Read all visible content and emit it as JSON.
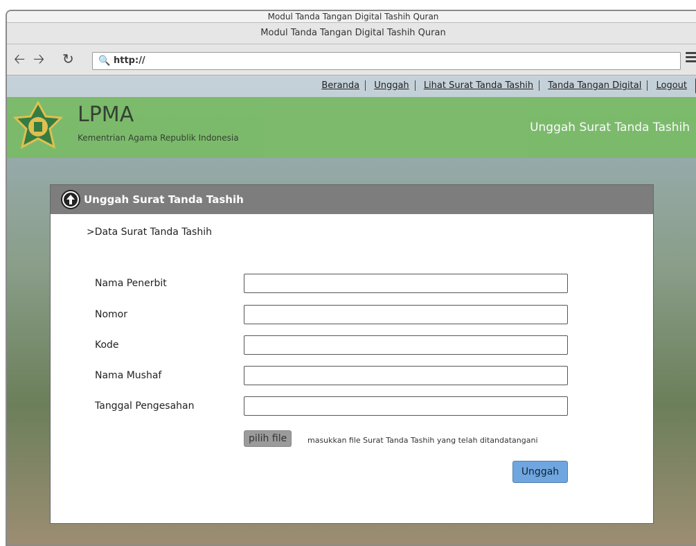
{
  "browser": {
    "title_strip": "Modul Tanda Tangan Digital Tashih Quran",
    "title": "Modul Tanda Tangan Digital Tashih Quran",
    "address": "http://"
  },
  "nav": {
    "links": [
      "Beranda",
      "Unggah",
      "Lihat Surat Tanda Tashih",
      "Tanda Tangan Digital",
      "Logout"
    ]
  },
  "header": {
    "brand": "LPMA",
    "subtitle": "Kementrian Agama Republik Indonesia",
    "page_title": "Unggah Surat Tanda Tashih"
  },
  "panel": {
    "title": "Unggah Surat Tanda Tashih",
    "section_label": ">Data Surat Tanda Tashih",
    "fields": [
      {
        "label": "Nama Penerbit",
        "value": ""
      },
      {
        "label": "Nomor",
        "value": ""
      },
      {
        "label": "Kode",
        "value": ""
      },
      {
        "label": "Nama Mushaf",
        "value": ""
      },
      {
        "label": "Tanggal Pengesahan",
        "value": ""
      }
    ],
    "file_button": "pilih file",
    "file_hint": "masukkan file Surat Tanda Tashih yang telah ditandatangani",
    "submit": "Unggah"
  },
  "colors": {
    "banner": "#7bbb68",
    "panel_header": "#7d7d7d",
    "submit": "#6fa6e0"
  }
}
